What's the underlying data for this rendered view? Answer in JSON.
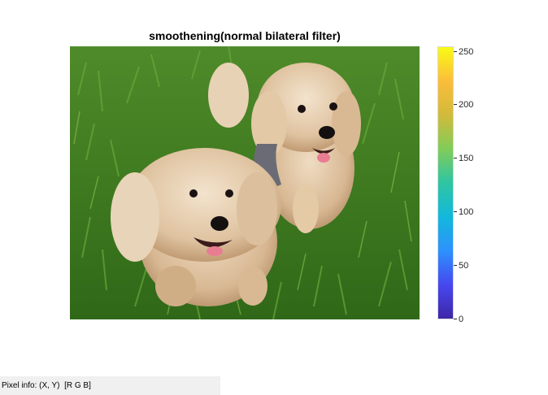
{
  "figure": {
    "title": "smoothening(normal bilateral filter)"
  },
  "image": {
    "subject": "two fluffy light-colored dogs running through green grass"
  },
  "colorbar": {
    "colormap": [
      "#3e26a8",
      "#4748f0",
      "#2d92fd",
      "#12b8dc",
      "#2ec5a2",
      "#81cc59",
      "#d2ba3a",
      "#fbbd3a",
      "#f9fb14"
    ],
    "ticks": [
      "0",
      "50",
      "100",
      "150",
      "200",
      "250"
    ],
    "tick_values": [
      0,
      50,
      100,
      150,
      200,
      250
    ],
    "range": [
      0,
      255
    ]
  },
  "status_bar": {
    "pixel_info_label": "Pixel info:",
    "pixel_info_coords": "(X, Y)",
    "pixel_info_rgb": "[R G B]"
  }
}
